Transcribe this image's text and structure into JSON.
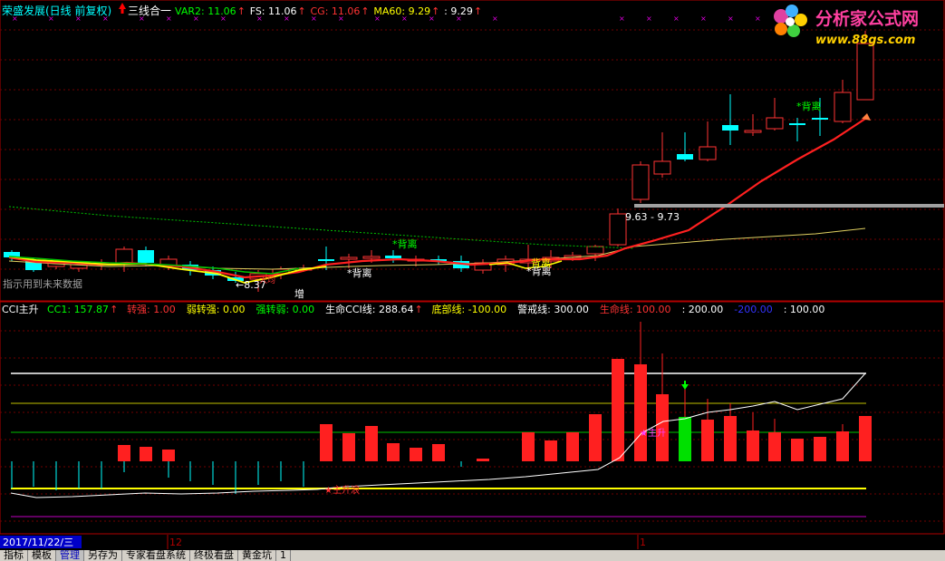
{
  "upper_panel": {
    "title": "荣盛发展(日线 前复权)",
    "formula": "三线合一",
    "indicators": [
      {
        "label": "VAR2: 11.06",
        "color": "#00ff00"
      },
      {
        "label": "FS: 11.06",
        "color": "#ffffff"
      },
      {
        "label": "CG: 11.06",
        "color": "#ff3333"
      },
      {
        "label": "MA60: 9.29",
        "color": "#ffff00"
      },
      {
        "label": ": 9.29",
        "color": "#ffffff"
      }
    ],
    "future_note": "指示用到未来数据",
    "price_label": "9.63 - 9.73",
    "low_label": "←8.37",
    "zeng_label": "增",
    "divergence_labels": [
      "*背离",
      "*背离",
      "*背离",
      "*背离",
      "背离"
    ],
    "extra_label": "大均"
  },
  "lower_panel": {
    "title": "CCI主升",
    "indicators": [
      {
        "label": "CC1: 157.87",
        "color": "#00ff00",
        "arrow": true
      },
      {
        "label": "转强: 1.00",
        "color": "#ff3333"
      },
      {
        "label": "弱转强: 0.00",
        "color": "#ffff00"
      },
      {
        "label": "强转弱: 0.00",
        "color": "#00ff00"
      },
      {
        "label": "生命CCI线: 288.64",
        "color": "#ffffff",
        "arrow": true
      },
      {
        "label": "底部线: -100.00",
        "color": "#ffff00"
      },
      {
        "label": "警戒线: 300.00",
        "color": "#ffffff"
      },
      {
        "label": "生命线: 100.00",
        "color": "#ff3333"
      },
      {
        "label": ": 200.00",
        "color": "#ffffff"
      },
      {
        "label": "-200.00",
        "color": "#3333ff"
      },
      {
        "label": ": 100.00",
        "color": "#ffffff"
      }
    ],
    "labels": [
      "主升",
      "主升浪"
    ]
  },
  "time_axis": {
    "date_badge": "2017/11/22/三",
    "month_ticks": [
      "12",
      "1"
    ]
  },
  "watermark": {
    "title": "分析家公式网",
    "url": "www.88gs.com"
  },
  "bottom_tabs": [
    "指标",
    "模板",
    "管理",
    "另存为",
    "专家看盘系统",
    "终极看盘",
    "黄金坑",
    "1"
  ]
}
